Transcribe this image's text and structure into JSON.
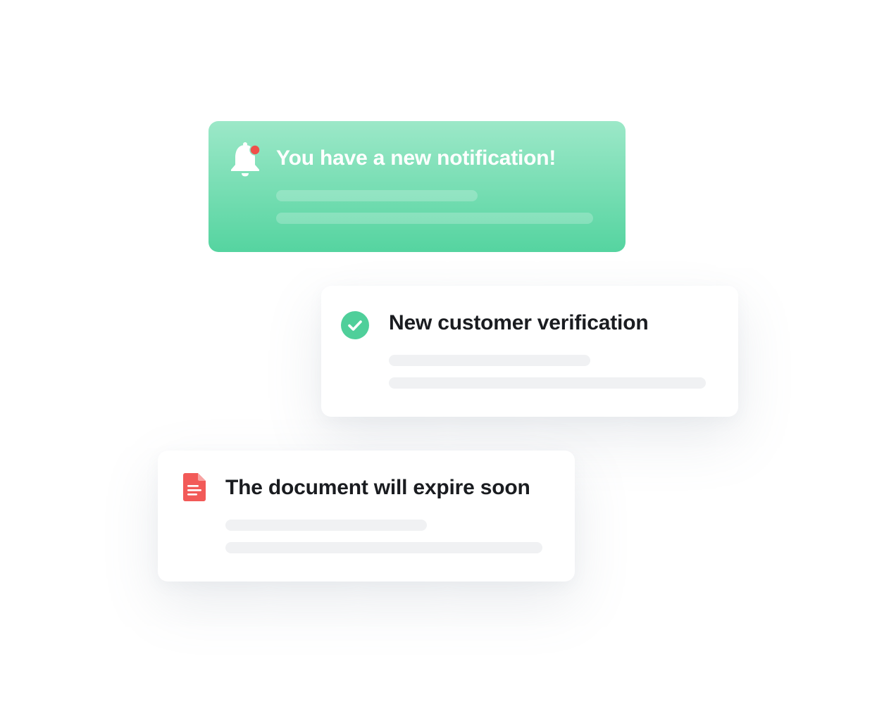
{
  "notifications": {
    "new_notification": {
      "title": "You have a new notification!",
      "icon": "bell-icon",
      "badge_color": "#f0504a",
      "background_top": "#9ce8c8",
      "background_bottom": "#55d4a0"
    },
    "verification": {
      "title": "New customer verification",
      "icon": "check-circle-icon",
      "icon_color": "#4fcf9a"
    },
    "document": {
      "title": "The document will expire soon",
      "icon": "document-icon",
      "icon_color": "#f25a58"
    }
  }
}
